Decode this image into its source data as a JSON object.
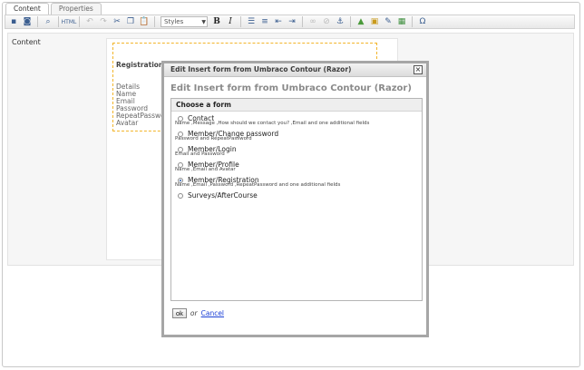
{
  "tabs": [
    {
      "label": "Content",
      "active": true
    },
    {
      "label": "Properties",
      "active": false
    }
  ],
  "toolbar": {
    "styles_select": "Styles",
    "bold": "B",
    "italic": "I",
    "omega": "Ω"
  },
  "content": {
    "field_label": "Content",
    "macro": {
      "title": "Registration",
      "fields": [
        "Details",
        "Name",
        "Email",
        "Password",
        "RepeatPassword",
        "Avatar"
      ]
    }
  },
  "dialog": {
    "title": "Edit Insert form from Umbraco Contour (Razor)",
    "heading": "Edit Insert form from Umbraco Contour (Razor)",
    "box_title": "Choose a form",
    "options": [
      {
        "label": "Contact",
        "checked": false,
        "description": "Name ,Message ,How should we contact you? ,Email and one additional fields"
      },
      {
        "label": "Member/Change password",
        "checked": false,
        "description": "Password and RepeatPassword"
      },
      {
        "label": "Member/Login",
        "checked": false,
        "description": "Email and Password"
      },
      {
        "label": "Member/Profile",
        "checked": false,
        "description": "Name ,Email and Avatar"
      },
      {
        "label": "Member/Registration",
        "checked": true,
        "description": "Name ,Email ,Password ,RepeatPassword and one additional fields"
      },
      {
        "label": "Surveys/AfterCourse",
        "checked": false,
        "description": ""
      }
    ],
    "ok_label": "ok",
    "or_text": "or",
    "cancel_label": "Cancel"
  },
  "colors": {
    "macro_border": "#f2b52a",
    "link": "#1a3fd6",
    "dialog_border": "#a6a6a6"
  }
}
